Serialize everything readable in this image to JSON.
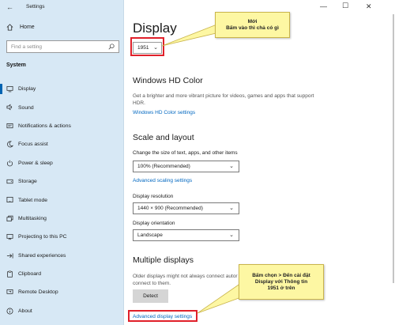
{
  "window": {
    "title": "Settings",
    "minimize_icon": "minimize-icon",
    "maximize_icon": "maximize-icon",
    "close_icon": "close-icon"
  },
  "sidebar": {
    "home": "Home",
    "search_placeholder": "Find a setting",
    "section": "System",
    "items": [
      {
        "label": "Display",
        "icon": "monitor-icon",
        "active": true
      },
      {
        "label": "Sound",
        "icon": "speaker-icon"
      },
      {
        "label": "Notifications & actions",
        "icon": "notification-icon"
      },
      {
        "label": "Focus assist",
        "icon": "moon-icon"
      },
      {
        "label": "Power & sleep",
        "icon": "power-icon"
      },
      {
        "label": "Storage",
        "icon": "storage-icon"
      },
      {
        "label": "Tablet mode",
        "icon": "tablet-icon"
      },
      {
        "label": "Multitasking",
        "icon": "multitasking-icon"
      },
      {
        "label": "Projecting to this PC",
        "icon": "projecting-icon"
      },
      {
        "label": "Shared experiences",
        "icon": "shared-icon"
      },
      {
        "label": "Clipboard",
        "icon": "clipboard-icon"
      },
      {
        "label": "Remote Desktop",
        "icon": "remote-icon"
      },
      {
        "label": "About",
        "icon": "info-icon"
      }
    ]
  },
  "main": {
    "title": "Display",
    "display_selector_value": "1951",
    "hd_color": {
      "heading": "Windows HD Color",
      "description": "Get a brighter and more vibrant picture for videos, games and apps that support HDR.",
      "link": "Windows HD Color settings"
    },
    "scale": {
      "heading": "Scale and layout",
      "size_label": "Change the size of text, apps, and other items",
      "size_value": "100% (Recommended)",
      "advanced_link": "Advanced scaling settings",
      "resolution_label": "Display resolution",
      "resolution_value": "1440 × 900 (Recommended)",
      "orientation_label": "Display orientation",
      "orientation_value": "Landscape"
    },
    "multiple": {
      "heading": "Multiple displays",
      "description": "Older displays might not always connect autor try to connect to them.",
      "detect_button": "Detect",
      "advanced_link": "Advanced display settings"
    }
  },
  "annotations": {
    "callout_top": [
      "Mới",
      "Bấm vào thì chả có gì"
    ],
    "callout_bottom": [
      "Bấm chọn > Đến cài đặt",
      "Display với Thông tin",
      "1951 ở trên"
    ],
    "highlight_color": "#e0202a",
    "callout_color": "#fdf7a3"
  }
}
